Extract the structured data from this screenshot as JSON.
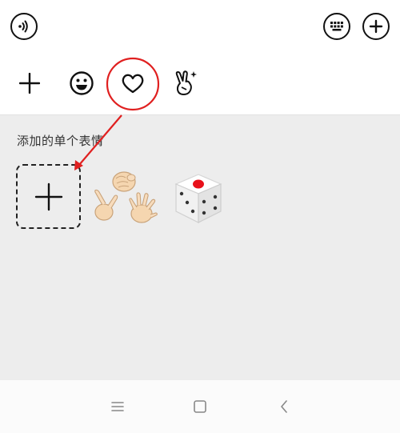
{
  "top_bar": {
    "icons": [
      "voice-icon",
      "keyboard-icon",
      "plus-circle-icon"
    ]
  },
  "tabs": {
    "items": [
      "add-icon",
      "emoji-icon",
      "heart-icon",
      "hand-gesture-icon"
    ],
    "selected": "heart-icon"
  },
  "panel": {
    "section_title": "添加的单个表情",
    "stickers": [
      "rock-paper-scissors-sticker",
      "dice-sticker"
    ]
  },
  "nav_bar": {
    "icons": [
      "menu-icon",
      "home-icon",
      "back-icon"
    ]
  },
  "colors": {
    "annotation": "#e02020",
    "panel_bg": "#ededed",
    "icon": "#111111"
  }
}
